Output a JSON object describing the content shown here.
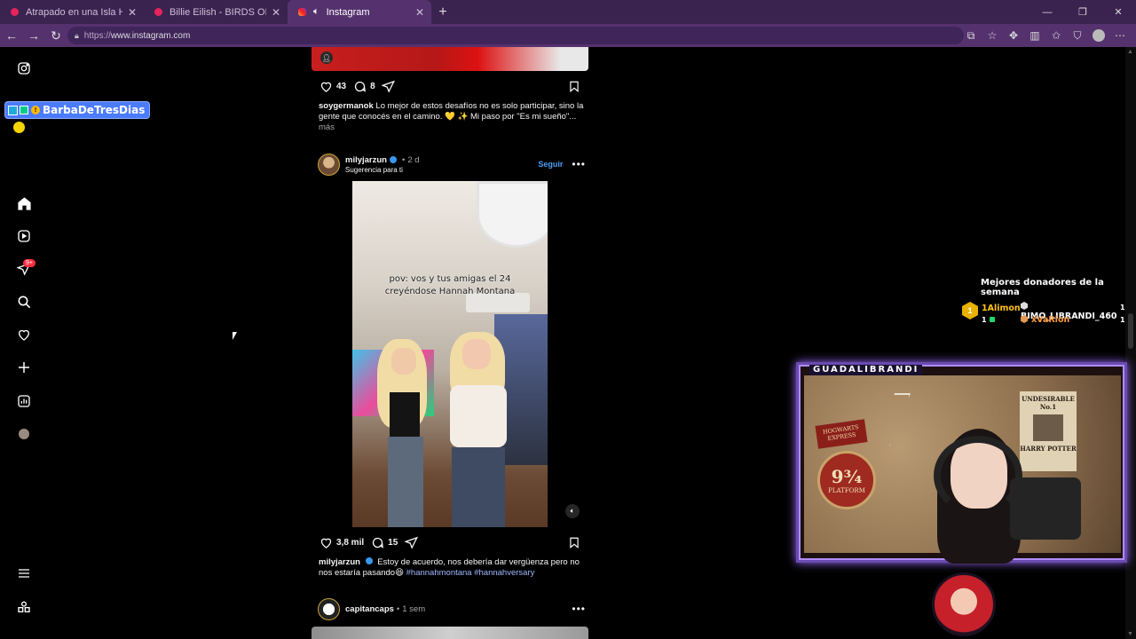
{
  "browser": {
    "tabs": [
      {
        "title": "Atrapado en una Isla Hasta que C",
        "active": false
      },
      {
        "title": "Billie Eilish - BIRDS OF A FEATHER",
        "active": false
      },
      {
        "title": "Instagram",
        "active": true
      }
    ],
    "url_proto": "https://",
    "url_host": "www.instagram.com"
  },
  "feed": {
    "post1": {
      "likes": "43",
      "comments": "8",
      "caption_user": "soygermanok",
      "caption_text": "Lo mejor de estos desafíos no es solo participar, sino la gente que conocés en el camino. 💛 ✨ Mi paso por \"Es mi sueño\"...",
      "more": "más"
    },
    "post2": {
      "username": "milyjarzun",
      "age": "2 d",
      "subtitle": "Sugerencia para ti",
      "follow": "Seguir",
      "video_text_line1": "pov: vos y tus amigas el 24",
      "video_text_line2": "creyéndose Hannah Montana",
      "likes": "3,8 mil",
      "comments": "15",
      "caption_user": "milyjarzun",
      "caption_text": "Estoy de acuerdo, nos debería dar vergüenza pero no nos estaría pasando😆",
      "hashtags": "#hannahmontana #hannahversary"
    },
    "post3": {
      "username": "capitancaps",
      "age": "1 sem"
    }
  },
  "sidenav": {
    "notifications_badge": "9+"
  },
  "stream": {
    "tip_name": "BarbaDeTresDias",
    "donors_title": "Mejores donadores de la semana",
    "donor1": "1Alimon",
    "donor1_count": "1",
    "donor2": "BIMO_LIBRANDI_460",
    "donor2_count": "1",
    "donor3": "xVaRion",
    "donor3_count": "1",
    "medal": "1",
    "cam_title": "GUADALIBRANDI",
    "poster_line1": "UNDESIRABLE",
    "poster_line2": "No.1",
    "poster_line3": "HARRY POTTER",
    "hogwarts_line1": "HOGWARTS",
    "hogwarts_line2": "EXPRESS",
    "platform_label": "PLATFORM",
    "platform_number": "9¾"
  },
  "colors": {
    "tabbar": "#3b2350",
    "addressbar": "#55326e",
    "link": "#4d9ef6",
    "badge": "#ff3040"
  }
}
